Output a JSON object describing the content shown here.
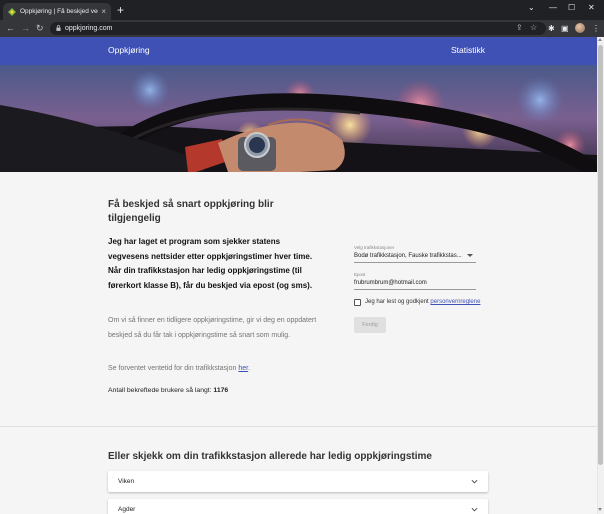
{
  "browser": {
    "tab_title": "Oppkjøring | Få beskjed ved ledig",
    "tab_close": "×",
    "new_tab": "+",
    "url": "oppkjoring.com",
    "minimize": "—",
    "maximize": "☐",
    "close": "✕",
    "back": "←",
    "forward": "→",
    "reload": "↻",
    "share": "⇪",
    "star": "☆",
    "extensions": "✱",
    "sidepanel": "▣",
    "menu": "⋮",
    "chevron_tabs": "⌄"
  },
  "appbar": {
    "brand": "Oppkjøring",
    "stats_link": "Statistikk",
    "color": "#3f51b5"
  },
  "hero": {
    "image_desc_icons": [
      "steering-wheel",
      "wristwatch",
      "hand"
    ]
  },
  "intro": {
    "headline": "Få beskjed så snart oppkjøring blir tilgjengelig",
    "lead": "Jeg har laget et program som sjekker statens vegvesens nettsider etter oppkjøringstimer hver time. Når din trafikkstasjon har ledig oppkjøringstime (til førerkort klasse B), får du beskjed via epost (og sms).",
    "para": "Om vi så finner en tidligere oppkjøringstime, gir vi deg en oppdatert beskjed så du får tak i oppkjøringstime så snart som mulig.",
    "wait_prefix": "Se forventet ventetid for din trafikkstasjon ",
    "wait_link": "her",
    "wait_suffix": ".",
    "count_prefix": "Antall bekreftede brukere så langt: ",
    "count_value": "1176"
  },
  "form": {
    "station_label": "Velg trafikkstasjoner",
    "station_value": "Bodø trafikkstasjon, Fauske trafikkstas...",
    "email_label": "Epost",
    "email_value": "frubrumbrum@hotmail.com",
    "terms_prefix": "Jeg har lest og godkjent ",
    "terms_link": "personvernreglene",
    "submit_label": "Ferdig"
  },
  "regions": {
    "title": "Eller skjekk om din trafikkstasjon allerede har ledig oppkjøringstime",
    "items": [
      {
        "label": "Viken"
      },
      {
        "label": "Agder"
      }
    ]
  }
}
